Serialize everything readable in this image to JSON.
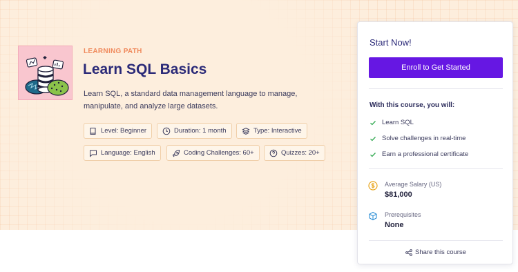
{
  "course": {
    "eyebrow": "LEARNING PATH",
    "title": "Learn SQL Basics",
    "description": "Learn SQL, a standard data management language to manage, manipulate, and analyze large datasets."
  },
  "chips": {
    "level": "Level: Beginner",
    "duration": "Duration: 1 month",
    "type": "Type: Interactive",
    "language": "Language: English",
    "challenges": "Coding Challenges: 60+",
    "quizzes": "Quizzes: 20+"
  },
  "card": {
    "title": "Start Now!",
    "enroll_label": "Enroll to Get Started",
    "with_title": "With this course, you will:",
    "benefits": [
      "Learn SQL",
      "Solve challenges in real-time",
      "Earn a professional certificate"
    ],
    "salary_label": "Average Salary (US)",
    "salary_value": "$81,000",
    "prereq_label": "Prerequisites",
    "prereq_value": "None",
    "share_label": "Share this course"
  },
  "colors": {
    "accent": "#6617e3",
    "hero_bg": "#fdeedd",
    "title": "#2b2a78",
    "eyebrow": "#f08a5d",
    "check": "#2fa84f"
  },
  "icons": {
    "level": "book-icon",
    "duration": "clock-icon",
    "type": "layers-icon",
    "language": "chat-bubble-icon",
    "challenges": "rocket-icon",
    "quizzes": "question-bubble-icon",
    "salary": "dollar-coin-icon",
    "prereq": "cube-icon",
    "share": "share-icon",
    "benefit": "checkmark-icon"
  }
}
